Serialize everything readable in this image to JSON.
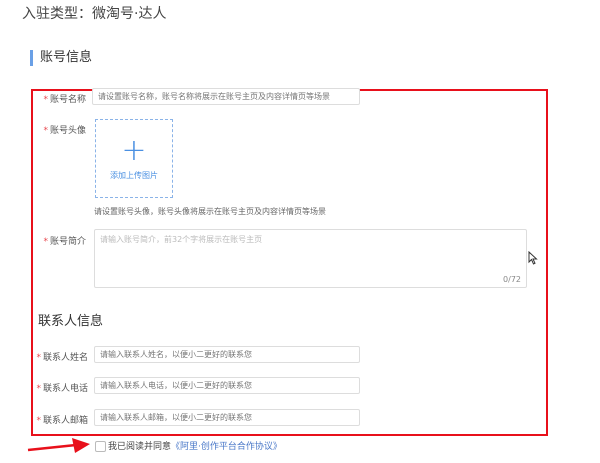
{
  "entry_type": "入驻类型：微淘号·达人",
  "account_section": "账号信息",
  "fields": {
    "name": {
      "label": "账号名称",
      "placeholder": "请设置账号名称，账号名称将展示在账号主页及内容详情页等场景"
    },
    "avatar": {
      "label": "账号头像",
      "upload_label": "添加上传图片",
      "hint": "请设置账号头像，账号头像将展示在账号主页及内容详情页等场景"
    },
    "intro": {
      "label": "账号简介",
      "placeholder": "请输入账号简介，前32个字将展示在账号主页",
      "counter": "0/72"
    }
  },
  "contact_section": "联系人信息",
  "contact": [
    {
      "label": "联系人姓名",
      "placeholder": "请输入联系人姓名，以便小二更好的联系您"
    },
    {
      "label": "联系人电话",
      "placeholder": "请输入联系人电话，以便小二更好的联系您"
    },
    {
      "label": "联系人邮箱",
      "placeholder": "请输入联系人邮箱，以便小二更好的联系您"
    }
  ],
  "agreement": {
    "text": "我已阅读并同意",
    "link": "《阿里·创作平台合作协议》"
  },
  "required_mark": "*",
  "plus_symbol": "+"
}
